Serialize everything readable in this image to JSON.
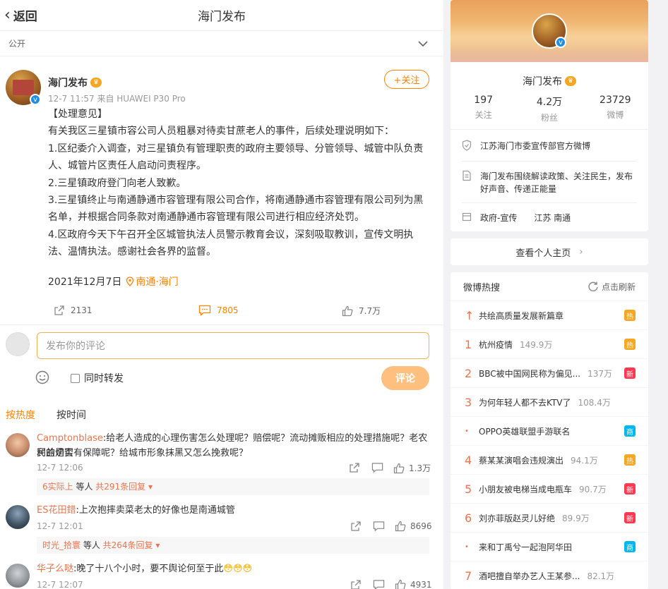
{
  "topbar": {
    "back": "返回",
    "title": "海门发布"
  },
  "visibility": "公开",
  "post": {
    "author": "海门发布",
    "meta": "12-7 11:57  来自 HUAWEI P30 Pro",
    "follow": "+关注",
    "lines": [
      "【处理意见】",
      "有关我区三星镇市容公司人员粗暴对待卖甘蔗老人的事件，后续处理说明如下：",
      "1.区纪委介入调查，对三星镇负有管理职责的政府主要领导、分管领导、城管中队负责",
      "人、城管片区责任人启动问责程序。",
      "2.三星镇政府登门向老人致歉。",
      "3.三星镇终止与南通静通市容管理有限公司合作，将南通静通市容管理有限公司列为黑",
      "名单，并根据合同条款对南通静通市容管理有限公司进行相应经济处罚。",
      "4.区政府今天下午召开全区城管执法人员警示教育会议，深刻吸取教训，宣传文明执",
      "法、温情执法。感谢社会各界的监督。"
    ],
    "date": "2021年12月7日",
    "location": "南通·海门",
    "reposts": "2131",
    "comments": "7805",
    "likes": "7.7万"
  },
  "composer": {
    "placeholder": "发布你的评论",
    "repost_label": "同时转发",
    "send": "评论"
  },
  "sort": {
    "hot": "按热度",
    "time": "按时间"
  },
  "comments": [
    {
      "name": "Camptonblase",
      "text": ":给老人造成的心理伤害怎么处理呢？赔偿呢？流动摊贩相应的处理措施呢？老农民的切实",
      "text2": "利益是否有保障呢？给城市形象抹黑又怎么挽救呢？",
      "time": "12-7 12:06",
      "likes": "1.3万",
      "reply_user": "6实际上",
      "reply_mid": " 等人 ",
      "reply_count": "共291条回复"
    },
    {
      "name": "ES花田錯",
      "text": ":上次抱摔卖菜老太的好像也是南通城管",
      "time": "12-7 12:01",
      "likes": "8696",
      "reply_user": "时光_拾寰",
      "reply_mid": " 等人 ",
      "reply_count": "共264条回复"
    },
    {
      "name": "华子么哒",
      "text": ":晚了十八个小时，要不舆论何至于此",
      "time": "12-7 12:07",
      "likes": "4931"
    }
  ],
  "profile": {
    "name": "海门发布",
    "stats": [
      {
        "num": "197",
        "label": "关注"
      },
      {
        "num": "4.2万",
        "label": "粉丝"
      },
      {
        "num": "23729",
        "label": "微博"
      }
    ],
    "verified": "江苏海门市委宣传部官方微博",
    "bio": "海门发布围绕解读政策、关注民生，发布好声音、传递正能量",
    "category": "政府-宣传",
    "region": "江苏 南通",
    "home_btn": "查看个人主页"
  },
  "hot": {
    "title": "微博热搜",
    "refresh": "点击刷新",
    "items": [
      {
        "rank": "↑",
        "title": "共绘高质量发展新篇章",
        "num": "",
        "badge": "热",
        "color": "#f5a623"
      },
      {
        "rank": "1",
        "title": "杭州疫情",
        "num": "149.9万",
        "badge": "热",
        "color": "#f5a623"
      },
      {
        "rank": "2",
        "title": "BBC被中国网民称为偏见...",
        "num": "137万",
        "badge": "新",
        "color": "#ff3852"
      },
      {
        "rank": "3",
        "title": "为何年轻人都不去KTV了",
        "num": "108.4万",
        "badge": "",
        "color": ""
      },
      {
        "rank": "•",
        "title": "OPPO英雄联盟手游联名",
        "num": "",
        "badge": "商",
        "color": "#00b7ee"
      },
      {
        "rank": "4",
        "title": "蔡某某演唱会违规演出",
        "num": "94.1万",
        "badge": "热",
        "color": "#f5a623"
      },
      {
        "rank": "5",
        "title": "小朋友被电梯当成电瓶车",
        "num": "90.7万",
        "badge": "新",
        "color": "#ff3852"
      },
      {
        "rank": "6",
        "title": "刘亦菲版赵灵儿好绝",
        "num": "89.9万",
        "badge": "新",
        "color": "#ff3852"
      },
      {
        "rank": "•",
        "title": "来和丁禹兮一起泡阿华田",
        "num": "",
        "badge": "商",
        "color": "#00b7ee"
      },
      {
        "rank": "7",
        "title": "酒吧擅自举办艺人王某参...",
        "num": "82.1万",
        "badge": "",
        "color": ""
      }
    ]
  }
}
